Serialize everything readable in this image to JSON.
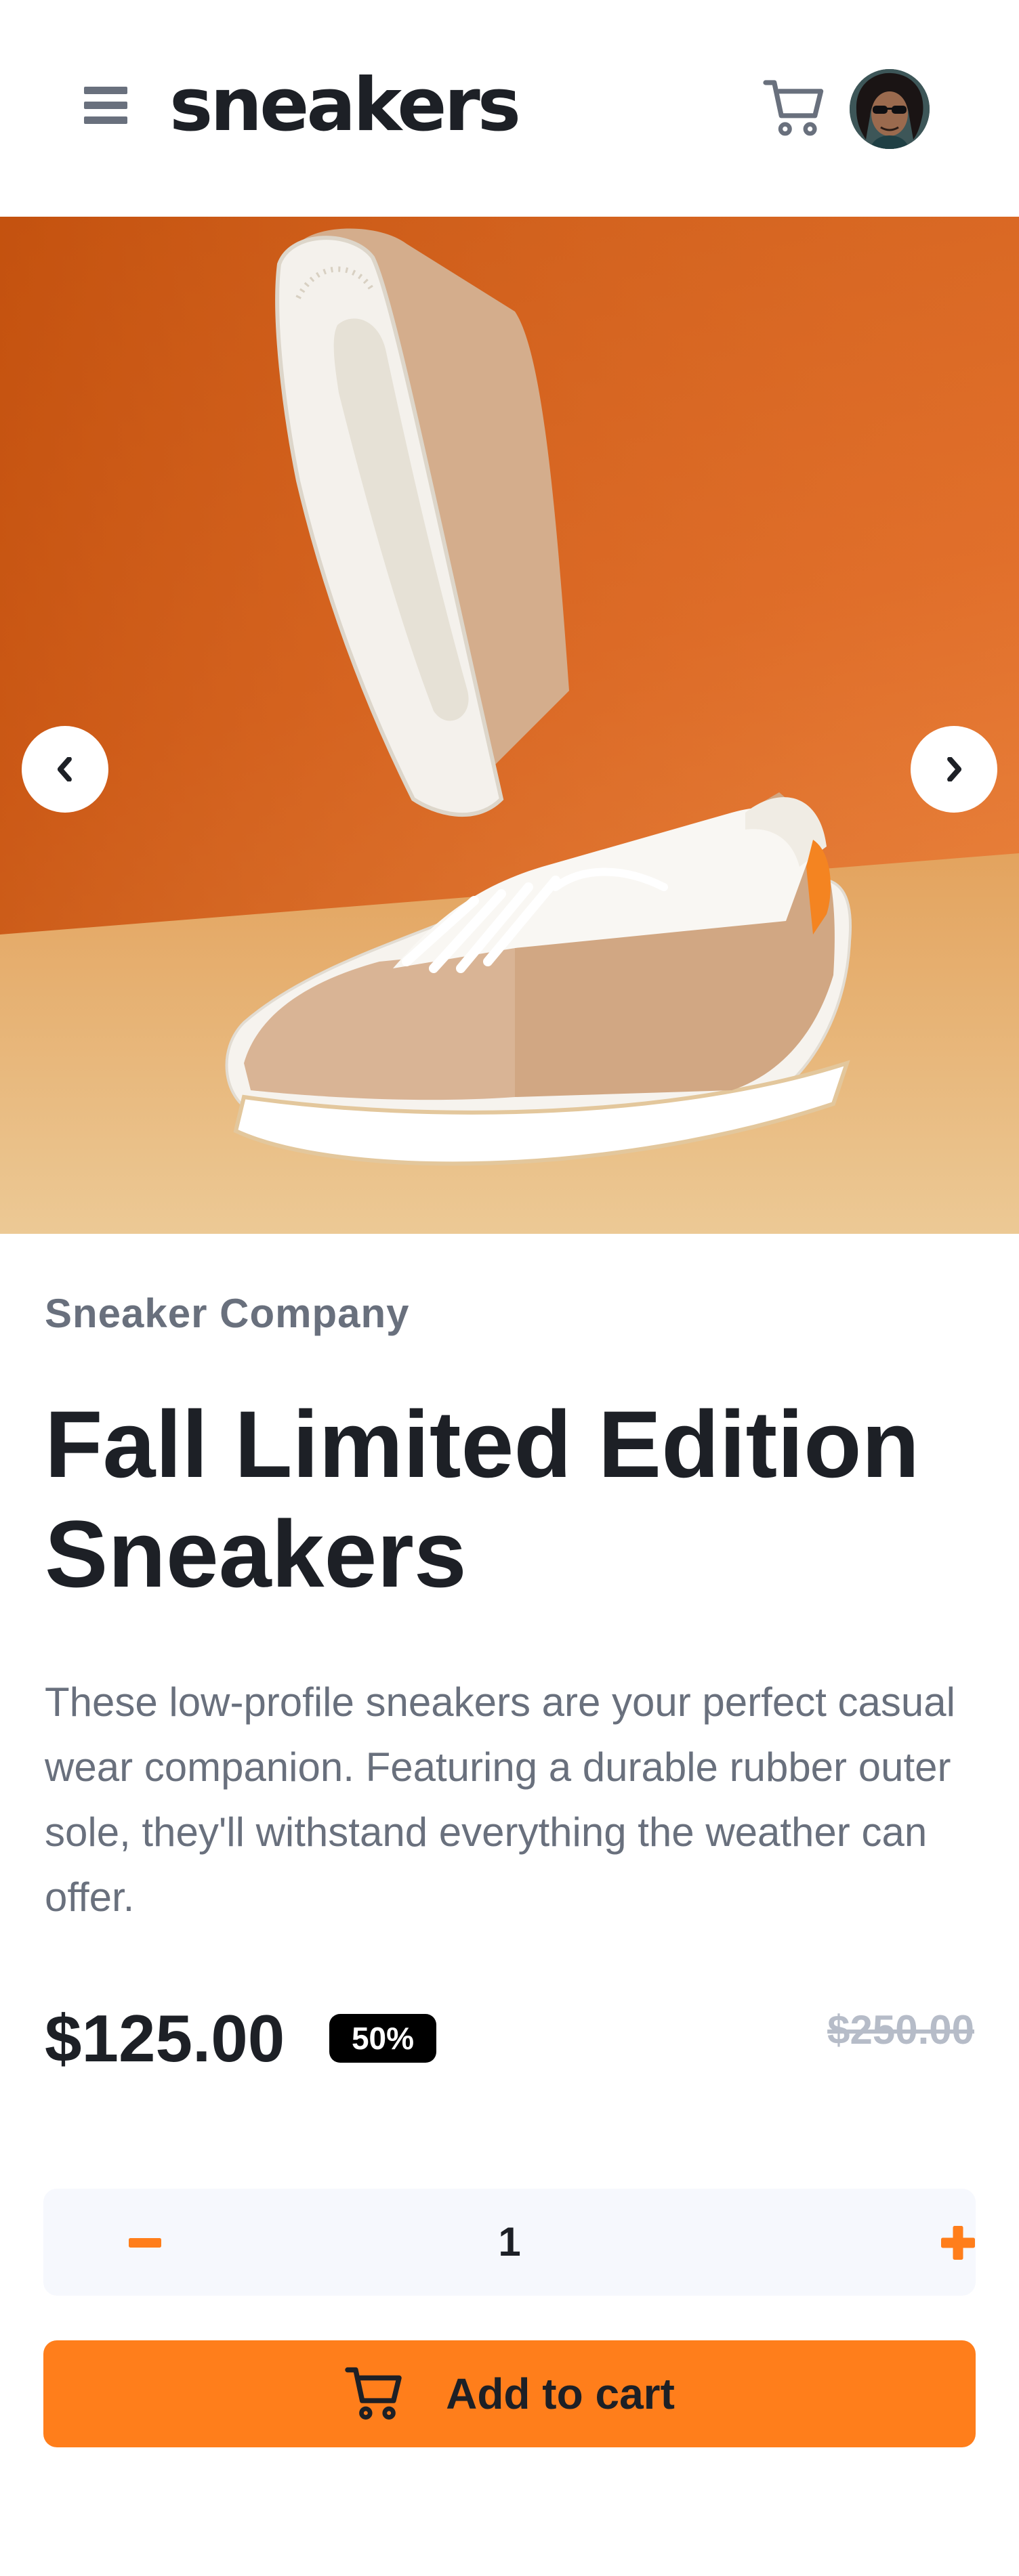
{
  "header": {
    "logo": "sneakers",
    "menu_icon": "hamburger-menu-icon",
    "cart_icon": "cart-icon",
    "avatar": "user-avatar"
  },
  "gallery": {
    "image": "Fall Limited Edition Sneakers product photo",
    "prev_icon": "chevron-left-icon",
    "next_icon": "chevron-right-icon"
  },
  "product": {
    "company": "Sneaker Company",
    "title": "Fall Limited Edition Sneakers",
    "description": "These low-profile sneakers are your perfect casual wear companion. Featuring a durable rubber outer sole, they'll withstand everything the weather can offer.",
    "price": "$125.00",
    "discount": "50%",
    "original_price": "$250.00"
  },
  "quantity": {
    "value": "1",
    "minus_icon": "minus-icon",
    "plus_icon": "plus-icon"
  },
  "add_to_cart": {
    "label": "Add to cart",
    "icon": "cart-icon"
  },
  "colors": {
    "accent": "#ff7e1b",
    "text_dark": "#1d2026",
    "text_muted": "#69707d",
    "old_price": "#b6bcc8",
    "qty_background": "#f6f8fd"
  }
}
